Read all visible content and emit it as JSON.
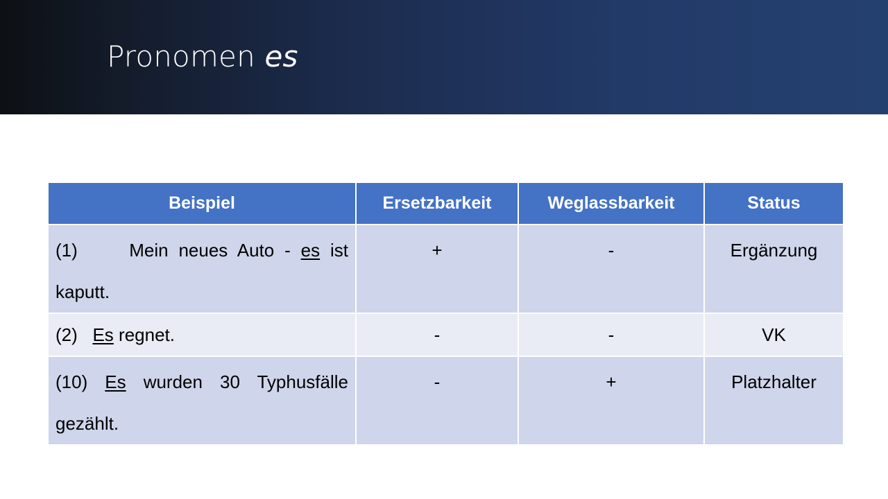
{
  "slide": {
    "title_main": "Pronomen",
    "title_em": "es"
  },
  "table": {
    "headers": [
      "Beispiel",
      "Ersetzbarkeit",
      "Weglassbarkeit",
      "Status"
    ],
    "rows": [
      {
        "number": "(1)",
        "pre": "Mein neues Auto -",
        "es": "es",
        "post": "ist kaputt.",
        "ersetzbarkeit": "+",
        "weglassbarkeit": "-",
        "status": "Ergänzung"
      },
      {
        "number": "(2)",
        "pre": "",
        "es": "Es",
        "post": "regnet.",
        "ersetzbarkeit": "-",
        "weglassbarkeit": "-",
        "status": "VK"
      },
      {
        "number": "(10)",
        "pre": "",
        "es": "Es",
        "post": "wurden 30 Typhusfälle gezählt.",
        "ersetzbarkeit": "-",
        "weglassbarkeit": "+",
        "status": "Platzhalter"
      }
    ]
  }
}
